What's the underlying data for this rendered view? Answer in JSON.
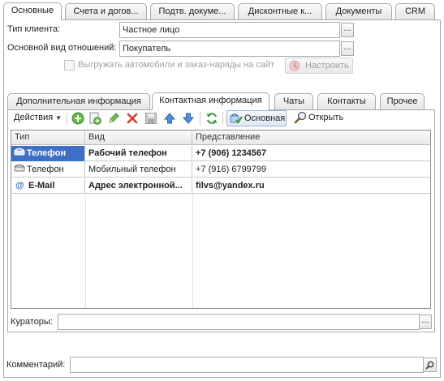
{
  "top_tabs": [
    {
      "label": "Основные",
      "active": true
    },
    {
      "label": "Счета и догов...",
      "active": false
    },
    {
      "label": "Подтв. докуме...",
      "active": false
    },
    {
      "label": "Дисконтные к...",
      "active": false
    },
    {
      "label": "Документы",
      "active": false
    },
    {
      "label": "CRM",
      "active": false
    }
  ],
  "form": {
    "client_type_label": "Тип клиента:",
    "client_type_value": "Частное лицо",
    "relation_label": "Основной вид отношений:",
    "relation_value": "Покупатель",
    "ellipsis": "...",
    "export_checkbox_label": "Выгружать автомобили и заказ-наряды на сайт",
    "configure_button": "Настроить",
    "curators_label": "Кураторы:",
    "curators_value": "",
    "comment_label": "Комментарий:",
    "comment_value": ""
  },
  "inner_tabs": [
    {
      "label": "Дополнительная информация",
      "active": false
    },
    {
      "label": "Контактная информация",
      "active": true
    },
    {
      "label": "Чаты",
      "active": false
    },
    {
      "label": "Контакты",
      "active": false
    },
    {
      "label": "Прочее",
      "active": false
    }
  ],
  "toolbar": {
    "actions_label": "Действия",
    "main_label": "Основная",
    "open_label": "Открыть"
  },
  "table": {
    "columns": [
      "Тип",
      "Вид",
      "Представление"
    ],
    "rows": [
      {
        "type": "Телефон",
        "kind": "Рабочий телефон",
        "value": "+7 (906) 1234567",
        "bold": true,
        "selected": true,
        "icon": "phone-icon"
      },
      {
        "type": "Телефон",
        "kind": "Мобильный телефон",
        "value": "+7 (916) 6799799",
        "bold": false,
        "selected": false,
        "icon": "phone-icon"
      },
      {
        "type": "E-Mail",
        "kind": "Адрес электронной...",
        "value": "filvs@yandex.ru",
        "bold": true,
        "selected": false,
        "icon": "at-icon"
      }
    ]
  },
  "colors": {
    "selection": "#3d6fc7",
    "email_icon": "#2f6fd6"
  }
}
